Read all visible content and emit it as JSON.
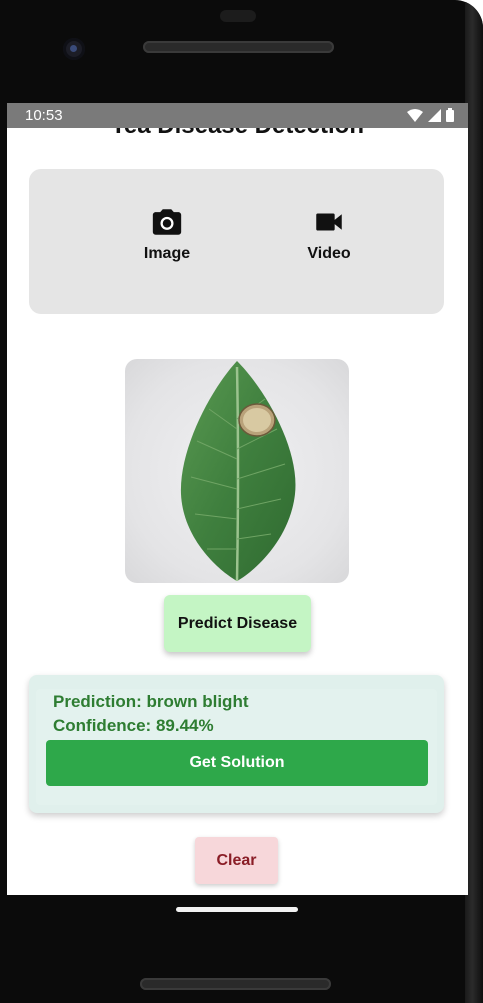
{
  "status_bar": {
    "time": "10:53"
  },
  "app": {
    "title": "Tea Disease Detection"
  },
  "media": {
    "image_label": "Image",
    "video_label": "Video"
  },
  "actions": {
    "predict_label": "Predict Disease",
    "solution_label": "Get Solution",
    "clear_label": "Clear"
  },
  "result": {
    "prediction_text": "Prediction: brown blight",
    "confidence_text": "Confidence: 89.44%"
  },
  "icons": {
    "image": "camera-icon",
    "video": "videocam-icon",
    "wifi": "wifi-icon",
    "signal": "signal-icon",
    "battery": "battery-icon"
  },
  "colors": {
    "predict_button": "#c4f5c4",
    "result_card": "#e0f0ec",
    "result_text": "#2e7d32",
    "solution_button": "#2ea84a",
    "clear_button": "#f7d7da",
    "clear_text": "#8a1d26"
  }
}
